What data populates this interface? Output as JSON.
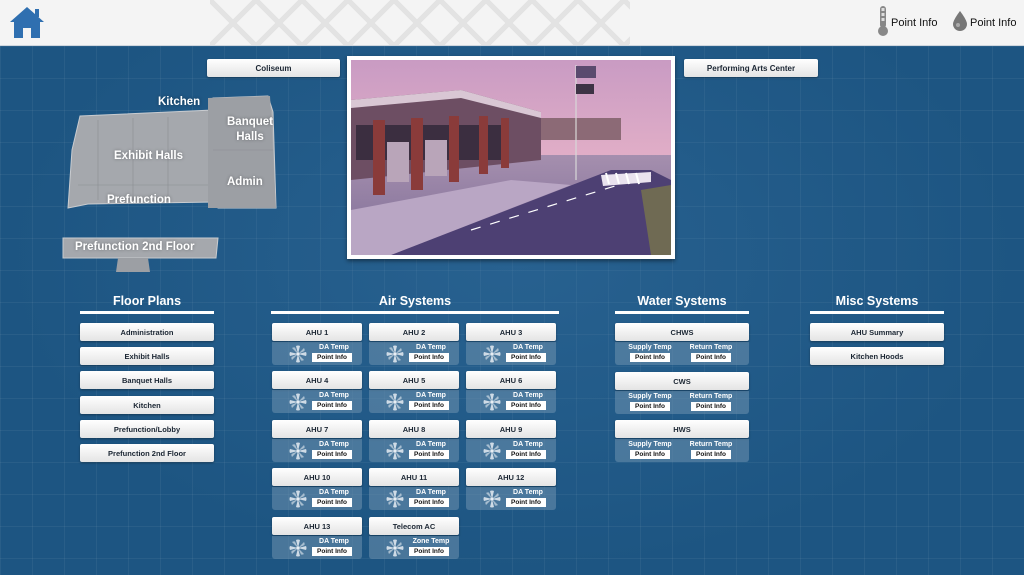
{
  "header": {
    "home_icon": "home-icon",
    "point_info_temp_label": "Point Info",
    "point_info_temp_icon": "thermometer-icon",
    "point_info_humidity_label": "Point Info",
    "point_info_humidity_icon": "water-drop-icon"
  },
  "nav": {
    "coliseum": "Coliseum",
    "performing_arts": "Performing Arts Center"
  },
  "floor_map": {
    "kitchen": "Kitchen",
    "banquet_halls": "Banquet Halls",
    "exhibit_halls": "Exhibit Halls",
    "admin": "Admin",
    "prefunction": "Prefunction",
    "prefunction_2nd": "Prefunction 2nd Floor"
  },
  "floor_plans": {
    "title": "Floor Plans",
    "items": [
      "Administration",
      "Exhibit Halls",
      "Banquet Halls",
      "Kitchen",
      "Prefunction/Lobby",
      "Prefunction 2nd Floor"
    ]
  },
  "air_systems": {
    "title": "Air Systems",
    "units": [
      {
        "name": "AHU 1",
        "label": "DA Temp",
        "button": "Point Info"
      },
      {
        "name": "AHU 2",
        "label": "DA Temp",
        "button": "Point Info"
      },
      {
        "name": "AHU 3",
        "label": "DA Temp",
        "button": "Point Info"
      },
      {
        "name": "AHU 4",
        "label": "DA Temp",
        "button": "Point Info"
      },
      {
        "name": "AHU 5",
        "label": "DA Temp",
        "button": "Point Info"
      },
      {
        "name": "AHU 6",
        "label": "DA Temp",
        "button": "Point Info"
      },
      {
        "name": "AHU 7",
        "label": "DA Temp",
        "button": "Point Info"
      },
      {
        "name": "AHU 8",
        "label": "DA Temp",
        "button": "Point Info"
      },
      {
        "name": "AHU 9",
        "label": "DA Temp",
        "button": "Point Info"
      },
      {
        "name": "AHU 10",
        "label": "DA Temp",
        "button": "Point Info"
      },
      {
        "name": "AHU 11",
        "label": "DA Temp",
        "button": "Point Info"
      },
      {
        "name": "AHU 12",
        "label": "DA Temp",
        "button": "Point Info"
      },
      {
        "name": "AHU 13",
        "label": "DA Temp",
        "button": "Point Info"
      },
      {
        "name": "Telecom AC",
        "label": "Zone Temp",
        "button": "Point Info"
      }
    ]
  },
  "water_systems": {
    "title": "Water Systems",
    "units": [
      {
        "name": "CHWS",
        "supply_label": "Supply Temp",
        "return_label": "Return Temp",
        "button": "Point Info"
      },
      {
        "name": "CWS",
        "supply_label": "Supply Temp",
        "return_label": "Return Temp",
        "button": "Point Info"
      },
      {
        "name": "HWS",
        "supply_label": "Supply Temp",
        "return_label": "Return Temp",
        "button": "Point Info"
      }
    ]
  },
  "misc_systems": {
    "title": "Misc Systems",
    "items": [
      "AHU Summary",
      "Kitchen Hoods"
    ]
  },
  "colors": {
    "background": "#1d5582",
    "header": "#f4f4f4",
    "home_icon": "#2f6fb0"
  }
}
